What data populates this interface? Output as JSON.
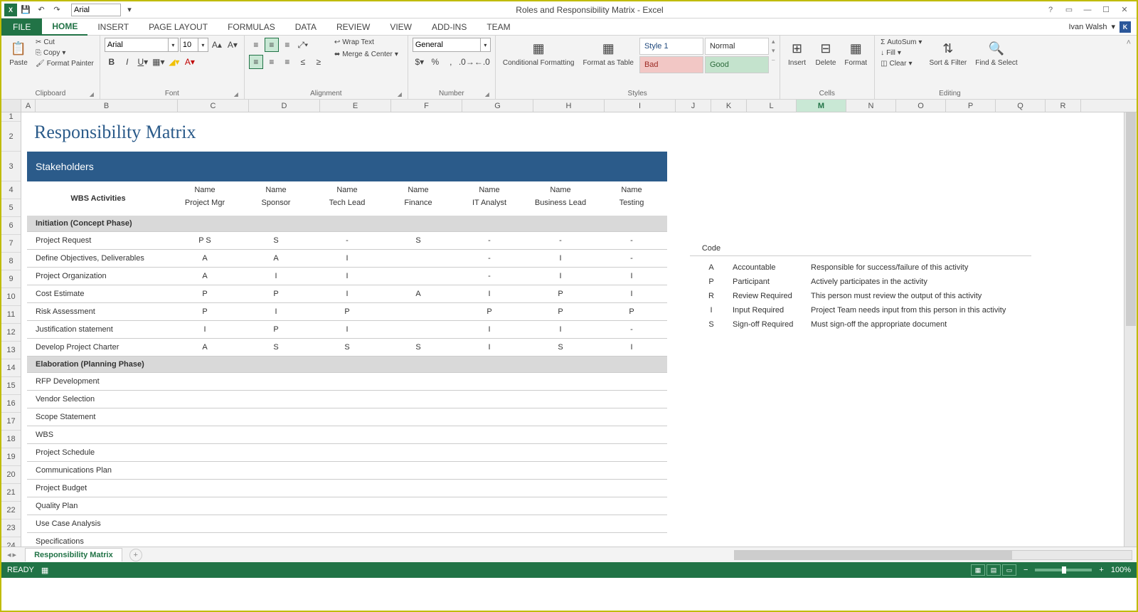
{
  "app": {
    "title": "Roles and Responsibility Matrix - Excel",
    "user": "Ivan Walsh",
    "userInitial": "K"
  },
  "qat": {
    "font": "Arial"
  },
  "tabs": {
    "file": "FILE",
    "items": [
      "HOME",
      "INSERT",
      "PAGE LAYOUT",
      "FORMULAS",
      "DATA",
      "REVIEW",
      "VIEW",
      "ADD-INS",
      "TEAM"
    ],
    "active": 0
  },
  "ribbon": {
    "clipboard": {
      "label": "Clipboard",
      "paste": "Paste",
      "cut": "Cut",
      "copy": "Copy",
      "fmt": "Format Painter"
    },
    "font": {
      "label": "Font",
      "name": "Arial",
      "size": "10"
    },
    "alignment": {
      "label": "Alignment",
      "wrap": "Wrap Text",
      "merge": "Merge & Center"
    },
    "number": {
      "label": "Number",
      "format": "General"
    },
    "styles": {
      "label": "Styles",
      "conditional": "Conditional Formatting",
      "formatAs": "Format as Table",
      "s1": "Style 1",
      "s2": "Normal",
      "s3": "Bad",
      "s4": "Good"
    },
    "cells": {
      "label": "Cells",
      "insert": "Insert",
      "delete": "Delete",
      "format": "Format"
    },
    "editing": {
      "label": "Editing",
      "autosum": "AutoSum",
      "fill": "Fill",
      "clear": "Clear",
      "sort": "Sort & Filter",
      "find": "Find & Select"
    }
  },
  "columns": [
    "A",
    "B",
    "C",
    "D",
    "E",
    "F",
    "G",
    "H",
    "I",
    "J",
    "K",
    "L",
    "M",
    "N",
    "O",
    "P",
    "Q",
    "R"
  ],
  "selectedCol": "M",
  "rows": [
    1,
    2,
    3,
    4,
    5,
    6,
    7,
    8,
    9,
    10,
    11,
    12,
    13,
    14,
    15,
    16,
    17,
    18,
    19,
    20,
    21,
    22,
    23,
    24
  ],
  "doc": {
    "title": "Responsibility Matrix",
    "banner": "Stakeholders",
    "activitiesHeader": "WBS Activities",
    "nameLabel": "Name",
    "roles": [
      "Project Mgr",
      "Sponsor",
      "Tech Lead",
      "Finance",
      "IT Analyst",
      "Business Lead",
      "Testing"
    ],
    "section1": "Initiation (Concept Phase)",
    "section2": "Elaboration (Planning Phase)",
    "rows1": [
      {
        "act": "Project Request",
        "c": [
          "P S",
          "S",
          "-",
          "S",
          "-",
          "-",
          "-"
        ]
      },
      {
        "act": "Define Objectives, Deliverables",
        "c": [
          "A",
          "A",
          "I",
          "",
          "-",
          "I",
          "-"
        ]
      },
      {
        "act": "Project Organization",
        "c": [
          "A",
          "I",
          "I",
          "",
          "-",
          "I",
          "I"
        ]
      },
      {
        "act": "Cost Estimate",
        "c": [
          "P",
          "P",
          "I",
          "A",
          "I",
          "P",
          "I"
        ]
      },
      {
        "act": "Risk Assessment",
        "c": [
          "P",
          "I",
          "P",
          "",
          "P",
          "P",
          "P"
        ]
      },
      {
        "act": "Justification statement",
        "c": [
          "I",
          "P",
          "I",
          "",
          "I",
          "I",
          "-"
        ]
      },
      {
        "act": "Develop Project Charter",
        "c": [
          "A",
          "S",
          "S",
          "S",
          "I",
          "S",
          "I"
        ]
      }
    ],
    "rows2": [
      {
        "act": "RFP Development"
      },
      {
        "act": "Vendor Selection"
      },
      {
        "act": "Scope Statement"
      },
      {
        "act": "WBS"
      },
      {
        "act": "Project Schedule"
      },
      {
        "act": "Communications Plan"
      },
      {
        "act": "Project Budget"
      },
      {
        "act": "Quality Plan"
      },
      {
        "act": "Use Case Analysis"
      },
      {
        "act": "Specifications"
      }
    ]
  },
  "legend": {
    "header": "Code",
    "rows": [
      {
        "code": "A",
        "name": "Accountable",
        "desc": "Responsible for success/failure of this activity"
      },
      {
        "code": "P",
        "name": "Participant",
        "desc": "Actively participates in the activity"
      },
      {
        "code": "R",
        "name": "Review Required",
        "desc": "This person must review the output of this activity"
      },
      {
        "code": "I",
        "name": "Input Required",
        "desc": "Project Team needs input from this person in this activity"
      },
      {
        "code": "S",
        "name": "Sign-off Required",
        "desc": "Must sign-off the appropriate document"
      }
    ]
  },
  "sheetTab": "Responsibility Matrix",
  "status": {
    "ready": "READY",
    "zoom": "100%"
  }
}
